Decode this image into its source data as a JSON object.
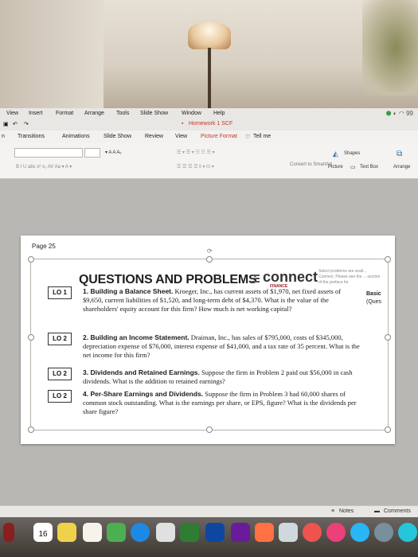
{
  "menubar": {
    "items": [
      "View",
      "Insert",
      "Format",
      "Arrange",
      "Tools",
      "Slide Show",
      "Window",
      "Help"
    ],
    "battery": "99"
  },
  "document": {
    "title": "Homework 1 SCF"
  },
  "ribbon_tabs": [
    "n",
    "Transitions",
    "Animations",
    "Slide Show",
    "Review",
    "View",
    "Picture Format",
    "Tell me"
  ],
  "ribbon": {
    "shapes_label": "Shapes",
    "picture_label": "Picture",
    "textbox_label": "Text Box",
    "arrange_label": "Arrange",
    "convert_label": "Convert to SmartArt"
  },
  "page": {
    "label": "Page 25",
    "heading": "QUESTIONS AND PROBLEMS",
    "connect_logo": "connect",
    "finance_tag": "FINANCE",
    "side_note": "Select problems are avail... Connect. Please see the ... section of the preface for",
    "right_col": [
      "Basic",
      "(Ques"
    ],
    "questions": [
      {
        "lo": "LO 1",
        "title": "1. Building a Balance Sheet.",
        "text": "Kroeger, Inc., has current assets of $1,970, net fixed assets of $9,650, current liabilities of $1,520, and long-term debt of $4,370. What is the value of the shareholders' equity account for this firm? How much is net working capital?"
      },
      {
        "lo": "LO 2",
        "title": "2. Building an Income Statement.",
        "text": "Draiman, Inc., has sales of $795,000, costs of $345,000, depreciation expense of $76,000, interest expense of $41,000, and a tax rate of 35 percent. What is the net income for this firm?"
      },
      {
        "lo": "LO 2",
        "title": "3. Dividends and Retained Earnings.",
        "text": "Suppose the firm in Problem 2 paid out $56,000 in cash dividends. What is the addition to retained earnings?"
      },
      {
        "lo": "LO 2",
        "title": "4. Per-Share Earnings and Dividends.",
        "text": "Suppose the firm in Problem 3 had 60,000 shares of common stock outstanding. What is the earnings per share, or EPS, figure? What is the dividends per share figure?"
      }
    ]
  },
  "statusbar": {
    "notes": "Notes",
    "comments": "Comments"
  },
  "dock": {
    "calendar_day": "16"
  }
}
